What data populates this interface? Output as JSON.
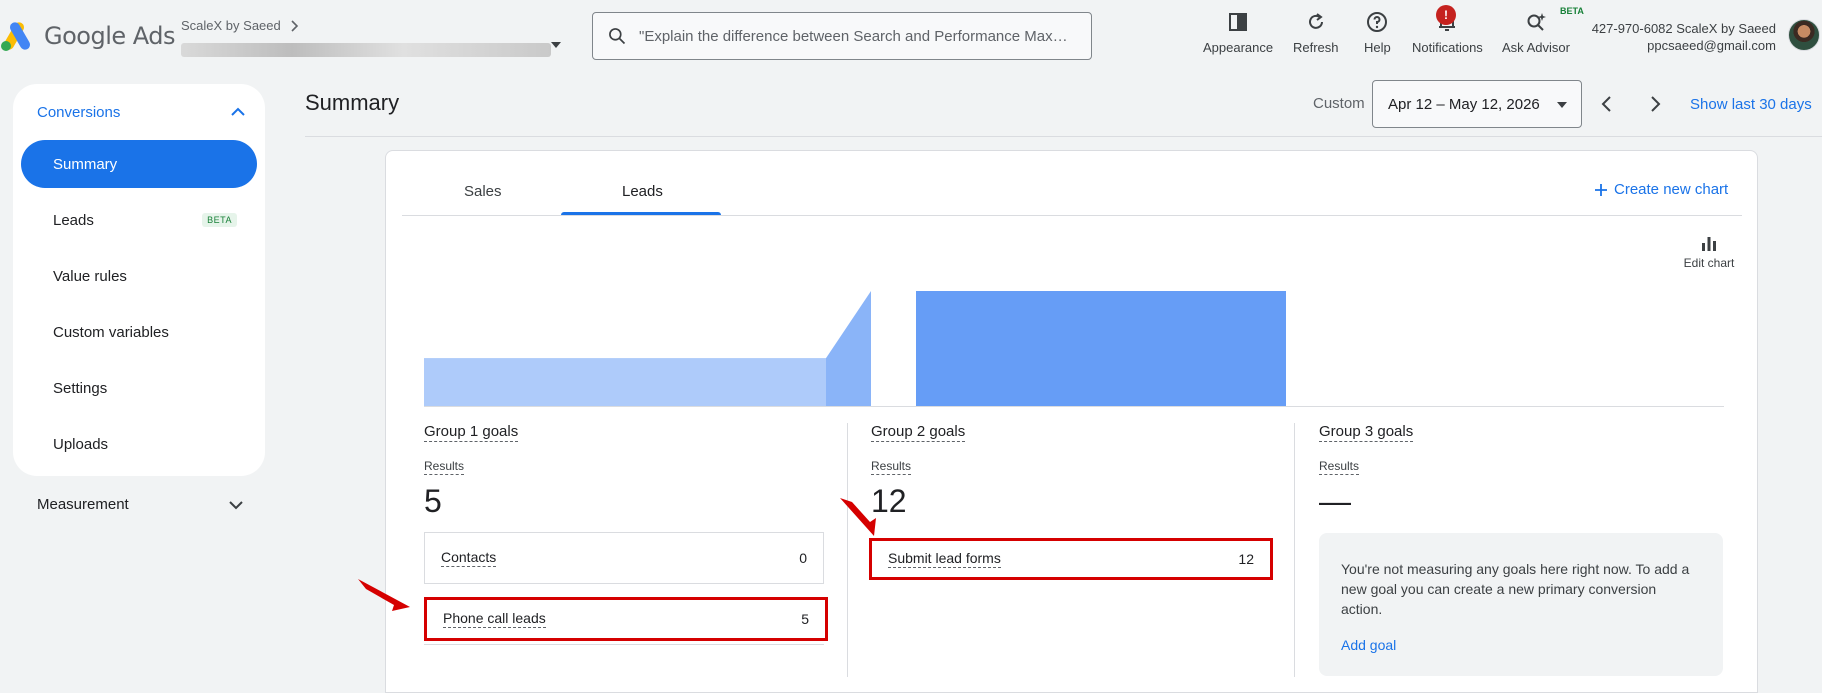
{
  "header": {
    "logo_text": "Google Ads",
    "account_name": "ScaleX by Saeed",
    "search_placeholder": "\"Explain the difference between Search and Performance Max cam...",
    "tools": [
      {
        "label": "Appearance",
        "icon": "appearance-icon"
      },
      {
        "label": "Refresh",
        "icon": "refresh-icon"
      },
      {
        "label": "Help",
        "icon": "help-icon"
      },
      {
        "label": "Notifications",
        "icon": "bell-icon",
        "badge": "!"
      },
      {
        "label": "Ask Advisor",
        "icon": "advisor-icon",
        "tag": "BETA"
      }
    ],
    "account_id_line": "427-970-6082 ScaleX by Saeed",
    "email": "ppcsaeed@gmail.com"
  },
  "sidenav": {
    "section": "Conversions",
    "items": [
      {
        "label": "Summary",
        "active": true
      },
      {
        "label": "Leads",
        "tag": "BETA"
      },
      {
        "label": "Value rules"
      },
      {
        "label": "Custom variables"
      },
      {
        "label": "Settings"
      },
      {
        "label": "Uploads"
      }
    ],
    "measurement": "Measurement"
  },
  "page": {
    "title": "Summary",
    "custom_label": "Custom",
    "date_range": "Apr 12 – May 12, 2026",
    "show_last": "Show last 30 days"
  },
  "card": {
    "tabs": [
      {
        "label": "Sales"
      },
      {
        "label": "Leads",
        "active": true
      }
    ],
    "create_chart": "Create new chart",
    "edit_chart": "Edit chart"
  },
  "chart_data": {
    "type": "area",
    "categories": [
      "Group 1 goals",
      "Group 2 goals",
      "Group 3 goals"
    ],
    "values": [
      5,
      12,
      0
    ],
    "colors": [
      "#aecbfa",
      "#669df6",
      "#e8f0fe"
    ]
  },
  "groups": [
    {
      "title": "Group 1 goals",
      "results_label": "Results",
      "results_value": "5",
      "goals": [
        {
          "name": "Contacts",
          "value": "0",
          "highlighted": false
        },
        {
          "name": "Phone call leads",
          "value": "5",
          "highlighted": true
        }
      ]
    },
    {
      "title": "Group 2 goals",
      "results_label": "Results",
      "results_value": "12",
      "goals": [
        {
          "name": "Submit lead forms",
          "value": "12",
          "highlighted": true
        }
      ]
    },
    {
      "title": "Group 3 goals",
      "results_label": "Results",
      "results_value": "—",
      "empty_message": "You're not measuring any goals here right now. To add a new goal you can create a new primary conversion action.",
      "add_goal": "Add goal"
    }
  ],
  "colors": {
    "accent": "#1a73e8",
    "highlight": "#d50000",
    "badge": "#c5221f"
  }
}
